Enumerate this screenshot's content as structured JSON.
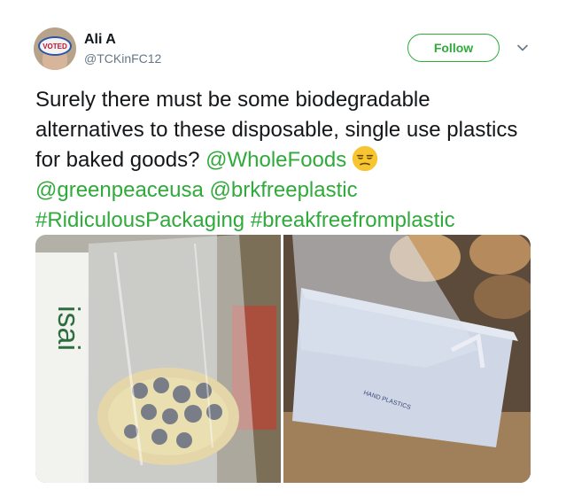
{
  "user": {
    "name": "Ali A",
    "handle": "@TCKinFC12",
    "avatar_badge": "VOTED"
  },
  "actions": {
    "follow_label": "Follow",
    "more_icon": "chevron-down-icon"
  },
  "tweet": {
    "text_before": "Surely there must be some biodegradable alternatives to these disposable, single use plastics for baked goods? ",
    "mention_wholefoods": "@WholeFoods",
    "emoji": "unamused-face-emoji",
    "mention_greenpeace": "@greenpeaceusa",
    "mention_brk": "@brkfreeplastic",
    "hashtag_ridiculous": "#RidiculousPackaging",
    "hashtag_breakfree": "#breakfreefromplastic"
  },
  "media": {
    "photo_left_label": "isai",
    "photo_right_box_text": "HAND PLASTICS"
  },
  "colors": {
    "accent": "#2faa3b",
    "text": "#14171a",
    "muted": "#657786"
  }
}
